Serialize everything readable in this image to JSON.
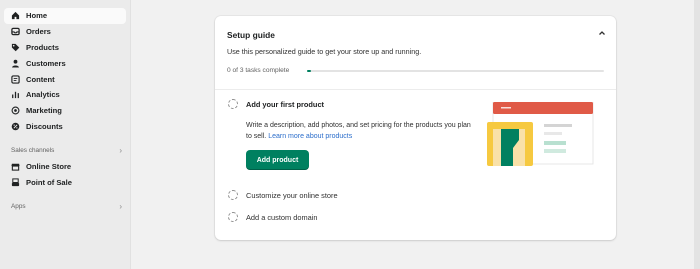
{
  "sidebar": {
    "items": [
      {
        "label": "Home",
        "icon": "home-icon",
        "active": true
      },
      {
        "label": "Orders",
        "icon": "orders-icon"
      },
      {
        "label": "Products",
        "icon": "tag-icon"
      },
      {
        "label": "Customers",
        "icon": "person-icon"
      },
      {
        "label": "Content",
        "icon": "content-icon"
      },
      {
        "label": "Analytics",
        "icon": "bar-chart-icon"
      },
      {
        "label": "Marketing",
        "icon": "target-icon"
      },
      {
        "label": "Discounts",
        "icon": "discount-icon"
      }
    ],
    "sales_channels": {
      "heading": "Sales channels",
      "items": [
        {
          "label": "Online Store",
          "icon": "storefront-icon"
        },
        {
          "label": "Point of Sale",
          "icon": "pos-icon"
        }
      ]
    },
    "apps": {
      "heading": "Apps"
    }
  },
  "setup_guide": {
    "title": "Setup guide",
    "subtitle": "Use this personalized guide to get your store up and running.",
    "progress_text": "0 of 3 tasks complete",
    "progress_fraction": 0.0,
    "tasks": [
      {
        "label": "Add your first product",
        "description": "Write a description, add photos, and set pricing for the products you plan to sell.",
        "link": "Learn more about products",
        "button": "Add product"
      },
      {
        "label": "Customize your online store"
      },
      {
        "label": "Add a custom domain"
      }
    ]
  },
  "colors": {
    "accent": "#008060",
    "link": "#2c6ecb",
    "illus_header": "#e05a47",
    "illus_yellow": "#f6c940",
    "illus_green": "#008060"
  }
}
